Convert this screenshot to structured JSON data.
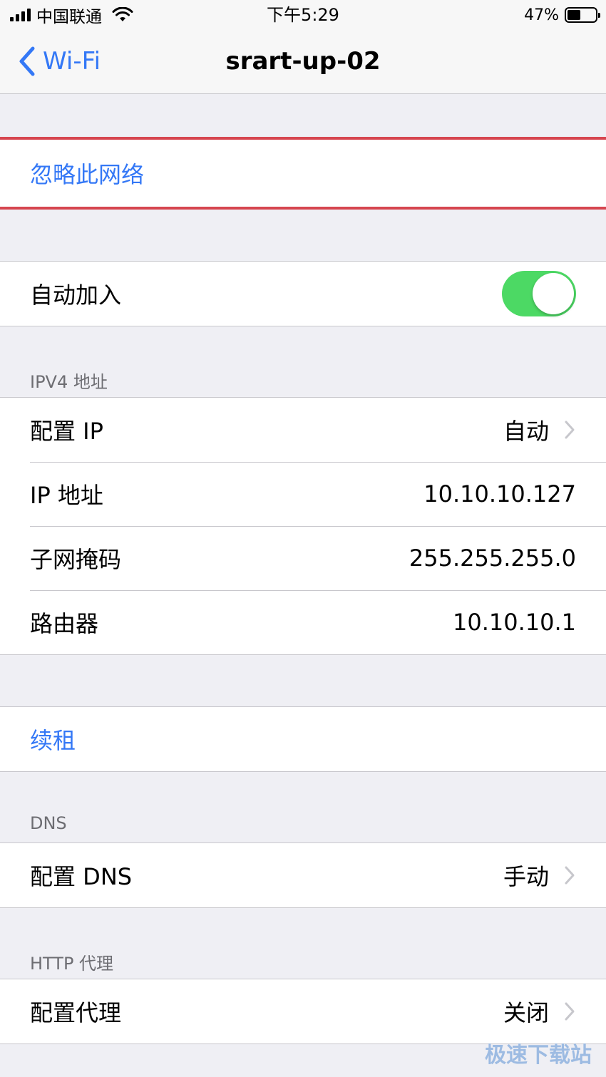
{
  "status": {
    "carrier": "中国联通",
    "time": "下午5:29",
    "battery": "47%",
    "battery_level": 0.47
  },
  "nav": {
    "back_label": "Wi-Fi",
    "title": "srart-up-02"
  },
  "forget": {
    "label": "忽略此网络"
  },
  "auto_join": {
    "label": "自动加入",
    "on": true
  },
  "ipv4": {
    "header": "IPV4 地址",
    "configure": {
      "label": "配置 IP",
      "value": "自动"
    },
    "ip": {
      "label": "IP 地址",
      "value": "10.10.10.127"
    },
    "mask": {
      "label": "子网掩码",
      "value": "255.255.255.0"
    },
    "router": {
      "label": "路由器",
      "value": "10.10.10.1"
    }
  },
  "renew": {
    "label": "续租"
  },
  "dns": {
    "header": "DNS",
    "configure": {
      "label": "配置 DNS",
      "value": "手动"
    }
  },
  "proxy": {
    "header": "HTTP 代理",
    "configure": {
      "label": "配置代理",
      "value": "关闭"
    }
  },
  "watermark": "极速下载站",
  "colors": {
    "accent": "#3478f6",
    "toggle_on": "#4cd964",
    "highlight": "#d6454f",
    "background": "#efeff4"
  },
  "icons": [
    "signal-icon",
    "wifi-icon",
    "battery-icon",
    "back-chevron-icon",
    "chevron-right-icon"
  ]
}
